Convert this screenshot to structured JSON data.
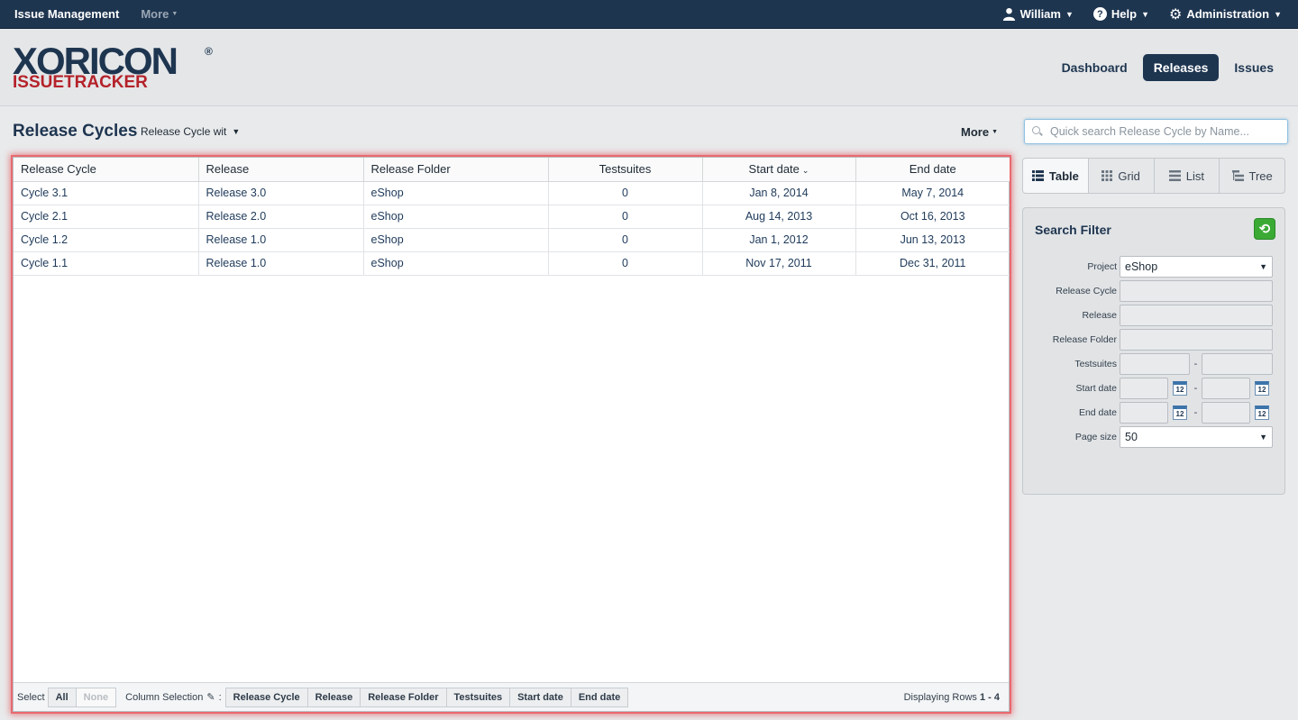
{
  "topbar": {
    "app_title": "Issue Management",
    "more": "More",
    "user": "William",
    "help": "Help",
    "admin": "Administration"
  },
  "logo": {
    "line1": "XORICON",
    "reg": "®",
    "line2": "ISSUETRACKER"
  },
  "mainnav": {
    "dashboard": "Dashboard",
    "releases": "Releases",
    "issues": "Issues"
  },
  "page": {
    "title": "Release Cycles",
    "view_select": "Release Cycle wit",
    "more": "More"
  },
  "table": {
    "columns": [
      "Release Cycle",
      "Release",
      "Release Folder",
      "Testsuites",
      "Start date",
      "End date"
    ],
    "rows": [
      [
        "Cycle 3.1",
        "Release 3.0",
        "eShop",
        "0",
        "Jan 8, 2014",
        "May 7, 2014"
      ],
      [
        "Cycle 2.1",
        "Release 2.0",
        "eShop",
        "0",
        "Aug 14, 2013",
        "Oct 16, 2013"
      ],
      [
        "Cycle 1.2",
        "Release 1.0",
        "eShop",
        "0",
        "Jan 1, 2012",
        "Jun 13, 2013"
      ],
      [
        "Cycle 1.1",
        "Release 1.0",
        "eShop",
        "0",
        "Nov 17, 2011",
        "Dec 31, 2011"
      ]
    ],
    "sorted_column": "Start date"
  },
  "footer": {
    "select_label": "Select",
    "all": "All",
    "none": "None",
    "column_selection": "Column Selection",
    "colon": ":",
    "col_buttons": [
      "Release Cycle",
      "Release",
      "Release Folder",
      "Testsuites",
      "Start date",
      "End date"
    ],
    "displaying": "Displaying Rows",
    "range": "1 - 4"
  },
  "search": {
    "placeholder": "Quick search Release Cycle by Name..."
  },
  "viewtabs": {
    "table": "Table",
    "grid": "Grid",
    "list": "List",
    "tree": "Tree"
  },
  "filter": {
    "title": "Search Filter",
    "project_label": "Project",
    "project_value": "eShop",
    "release_cycle_label": "Release Cycle",
    "release_label": "Release",
    "release_folder_label": "Release Folder",
    "testsuites_label": "Testsuites",
    "start_date_label": "Start date",
    "end_date_label": "End date",
    "page_size_label": "Page size",
    "page_size_value": "50",
    "dash": "-",
    "cal_day": "12"
  }
}
